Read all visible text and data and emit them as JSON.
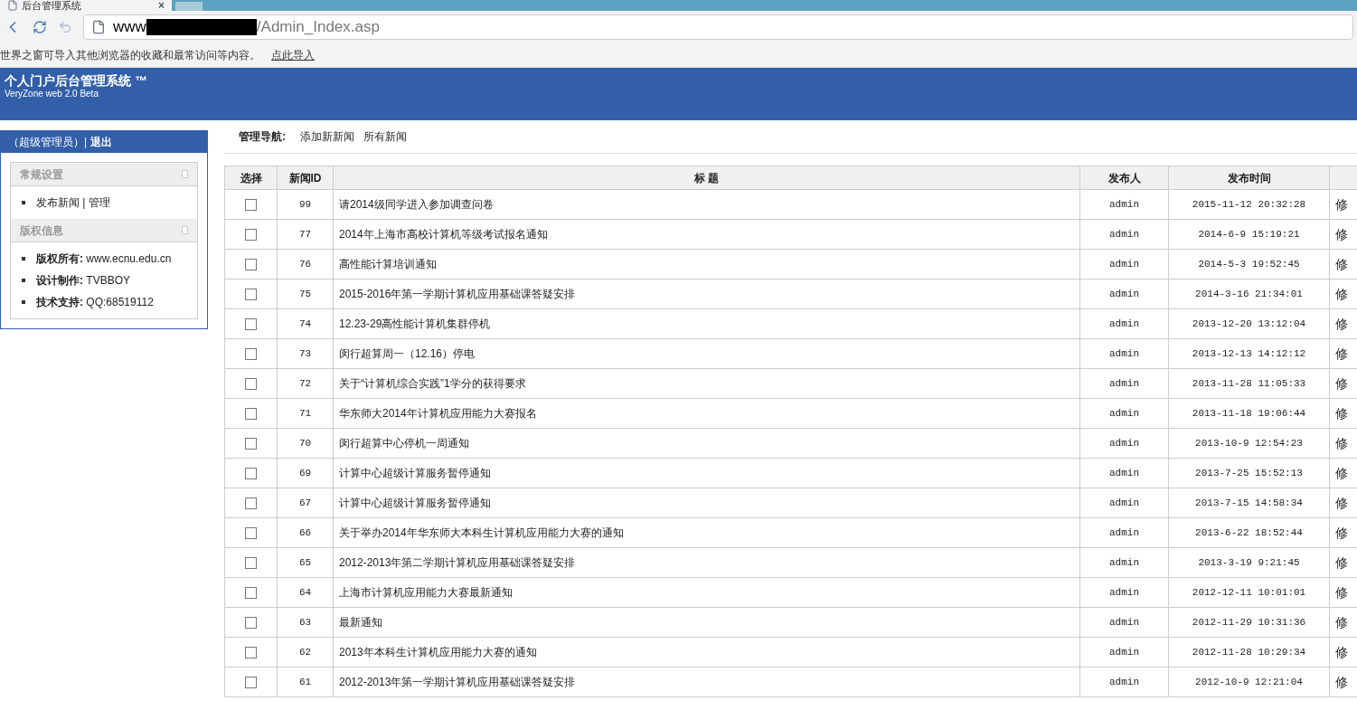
{
  "browser": {
    "tab": {
      "title": "后台管理系统",
      "close": "×"
    },
    "address": {
      "prefix": "www",
      "redacted": true,
      "suffix": "/Admin_Index.asp"
    },
    "infobar": {
      "message": "世界之窗可导入其他浏览器的收藏和最常访问等内容。",
      "link": "点此导入"
    }
  },
  "header": {
    "title": "个人门户后台管理系统 ™",
    "subtitle": "VeryZone web 2.0 Beta"
  },
  "sidebar": {
    "user": "（超级管理员）|",
    "logout": "退出",
    "sections": [
      {
        "title": "常规设置",
        "items": [
          {
            "text": "发布新闻 | 管理"
          }
        ]
      },
      {
        "title": "版权信息",
        "items": [
          {
            "text": "**版权所有:** www.ecnu.edu.cn"
          },
          {
            "text": "**设计制作:** TVBBOY"
          },
          {
            "text": "**技术支持:** QQ:68519112"
          }
        ]
      }
    ]
  },
  "nav": {
    "label": "管理导航:",
    "links": [
      "添加新新闻",
      "所有新闻"
    ]
  },
  "table": {
    "columns": [
      "选择",
      "新闻ID",
      "标 题",
      "发布人",
      "发布时间"
    ],
    "rows": [
      {
        "checked": false,
        "id": "99",
        "title": "请2014级同学进入参加调查问卷",
        "author": "admin",
        "time": "2015-11-12 20:32:28",
        "action": "修"
      },
      {
        "checked": false,
        "id": "77",
        "title": "2014年上海市高校计算机等级考试报名通知",
        "author": "admin",
        "time": "2014-6-9 15:19:21",
        "action": "修"
      },
      {
        "checked": false,
        "id": "76",
        "title": "高性能计算培训通知",
        "author": "admin",
        "time": "2014-5-3 19:52:45",
        "action": "修"
      },
      {
        "checked": false,
        "id": "75",
        "title": "2015-2016年第一学期计算机应用基础课答疑安排",
        "author": "admin",
        "time": "2014-3-16 21:34:01",
        "action": "修"
      },
      {
        "checked": false,
        "id": "74",
        "title": "12.23-29高性能计算机集群停机",
        "author": "admin",
        "time": "2013-12-20 13:12:04",
        "action": "修"
      },
      {
        "checked": false,
        "id": "73",
        "title": "闵行超算周一（12.16）停电",
        "author": "admin",
        "time": "2013-12-13 14:12:12",
        "action": "修"
      },
      {
        "checked": false,
        "id": "72",
        "title": "关于“计算机综合实践”1学分的获得要求",
        "author": "admin",
        "time": "2013-11-28 11:05:33",
        "action": "修"
      },
      {
        "checked": false,
        "id": "71",
        "title": "华东师大2014年计算机应用能力大赛报名",
        "author": "admin",
        "time": "2013-11-18 19:06:44",
        "action": "修"
      },
      {
        "checked": false,
        "id": "70",
        "title": "闵行超算中心停机一周通知",
        "author": "admin",
        "time": "2013-10-9 12:54:23",
        "action": "修"
      },
      {
        "checked": false,
        "id": "69",
        "title": "计算中心超级计算服务暂停通知",
        "author": "admin",
        "time": "2013-7-25 15:52:13",
        "action": "修"
      },
      {
        "checked": false,
        "id": "67",
        "title": "计算中心超级计算服务暂停通知",
        "author": "admin",
        "time": "2013-7-15 14:58:34",
        "action": "修"
      },
      {
        "checked": false,
        "id": "66",
        "title": "关于举办2014年华东师大本科生计算机应用能力大赛的通知",
        "author": "admin",
        "time": "2013-6-22 18:52:44",
        "action": "修"
      },
      {
        "checked": false,
        "id": "65",
        "title": "2012-2013年第二学期计算机应用基础课答疑安排",
        "author": "admin",
        "time": "2013-3-19 9:21:45",
        "action": "修"
      },
      {
        "checked": false,
        "id": "64",
        "title": "上海市计算机应用能力大赛最新通知",
        "author": "admin",
        "time": "2012-12-11 10:01:01",
        "action": "修"
      },
      {
        "checked": false,
        "id": "63",
        "title": "最新通知",
        "author": "admin",
        "time": "2012-11-29 10:31:36",
        "action": "修"
      },
      {
        "checked": false,
        "id": "62",
        "title": "2013年本科生计算机应用能力大赛的通知",
        "author": "admin",
        "time": "2012-11-28 10:29:34",
        "action": "修"
      },
      {
        "checked": false,
        "id": "61",
        "title": "2012-2013年第一学期计算机应用基础课答疑安排",
        "author": "admin",
        "time": "2012-10-9 12:21:04",
        "action": "修"
      }
    ]
  }
}
